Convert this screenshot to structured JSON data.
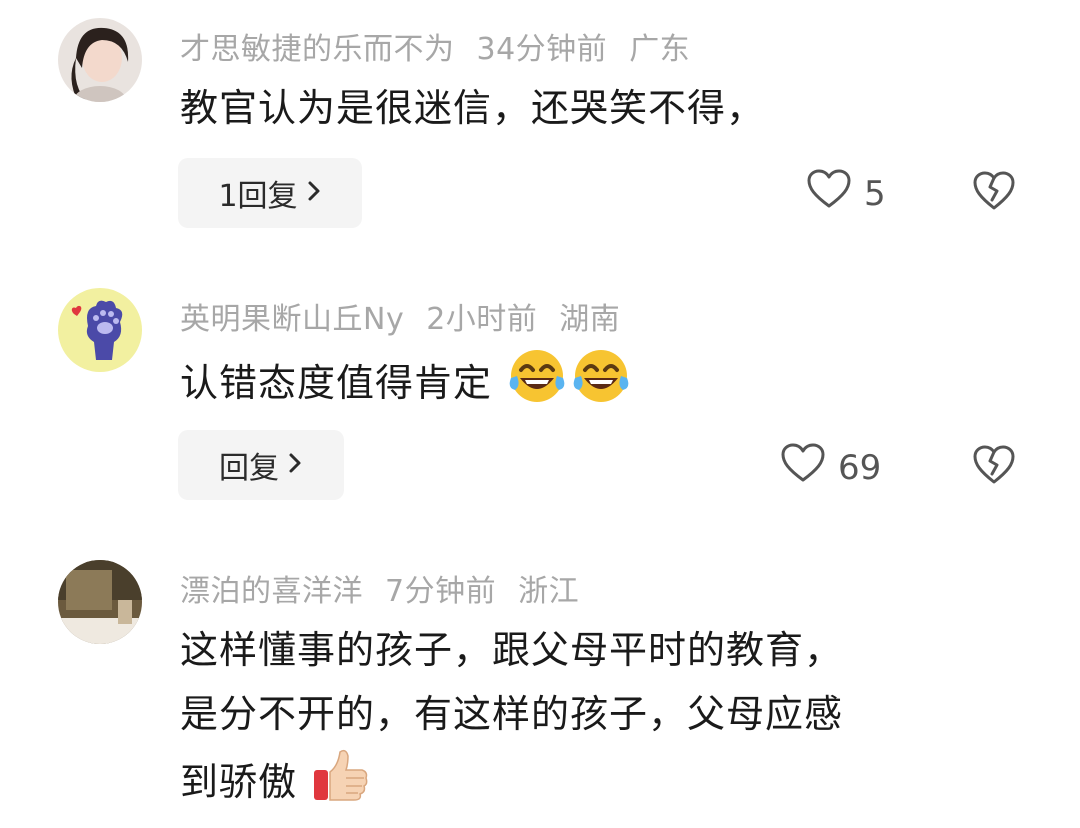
{
  "comments": [
    {
      "username": "才思敏捷的乐而不为",
      "time": "34分钟前",
      "location": "广东",
      "text_lines": [
        "教官认为是很迷信，还哭笑不得，"
      ],
      "reply_label": "1回复",
      "likes": "5",
      "icons": [
        "heart-icon",
        "broken-heart-icon",
        "chevron-right-icon"
      ]
    },
    {
      "username": "英明果断山丘Ny",
      "time": "2小时前",
      "location": "湖南",
      "text_lines": [
        "认错态度值得肯定"
      ],
      "reply_label": "回复",
      "likes": "69",
      "icons": [
        "laughing-crying-emoji",
        "laughing-crying-emoji",
        "heart-icon",
        "broken-heart-icon"
      ]
    },
    {
      "username": "漂泊的喜洋洋",
      "time": "7分钟前",
      "location": "浙江",
      "text_lines": [
        "这样懂事的孩子，跟父母平时的教育，",
        "是分不开的，有这样的孩子，父母应感",
        "到骄傲"
      ],
      "icons": [
        "thumbs-up-emoji"
      ]
    }
  ],
  "colors": {
    "meta": "#a7a7a7",
    "text": "#1a1a1a",
    "reply_bg": "#f4f4f4"
  }
}
